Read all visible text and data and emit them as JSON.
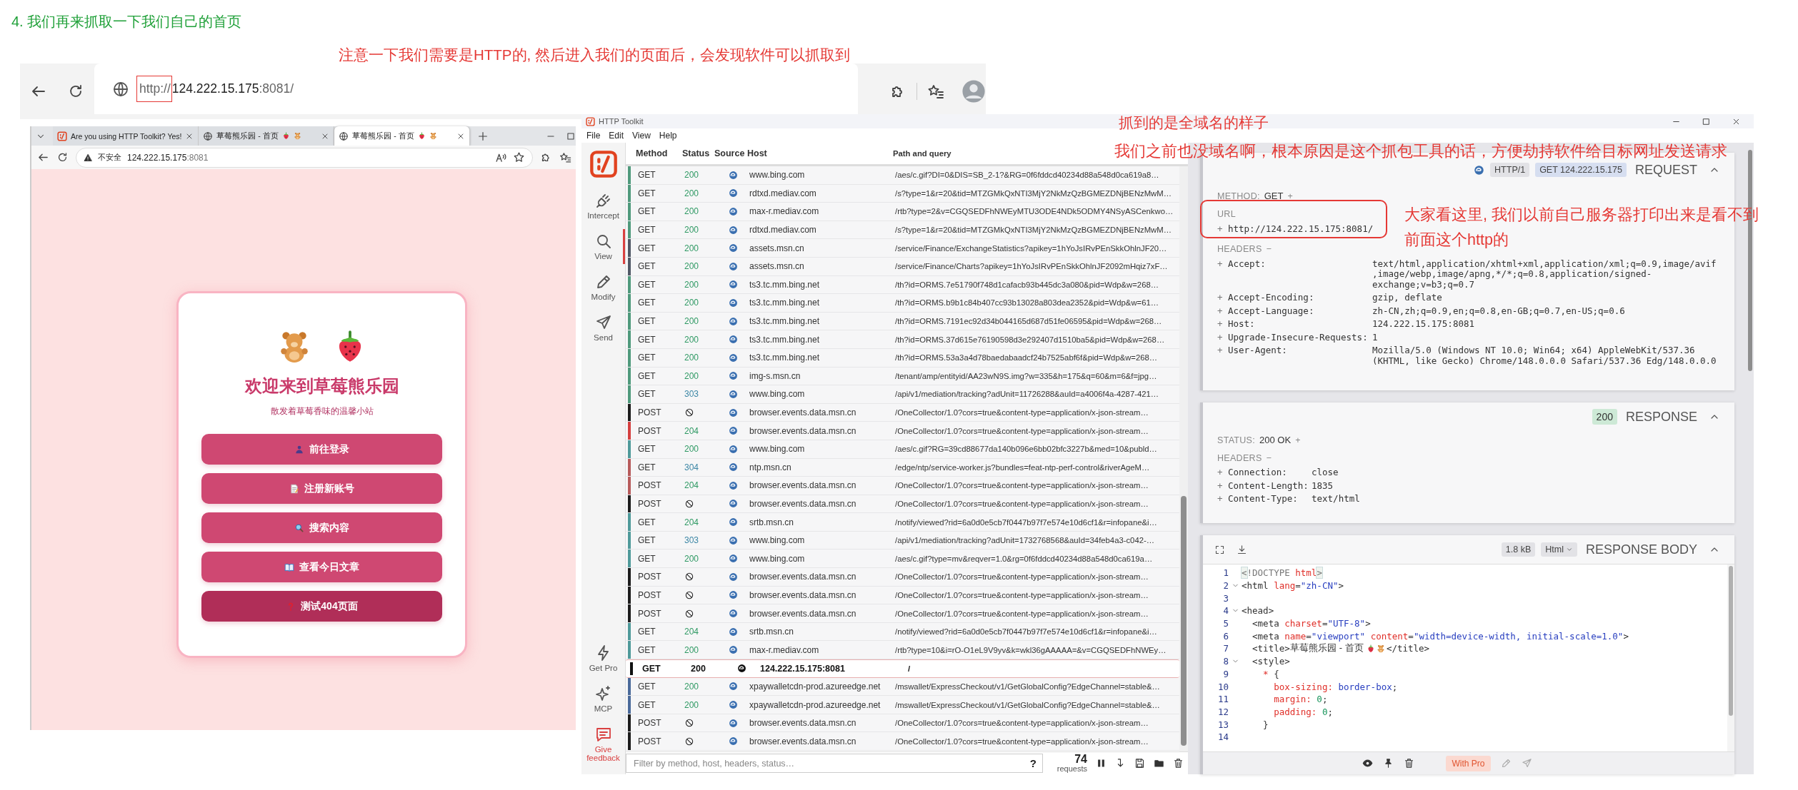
{
  "heading": "4. 我们再来抓取一下我们自己的首页",
  "annotations": [
    "注意一下我们需要是HTTP的, 然后进入我们的页面后，会发现软件可以抓取到",
    "抓到的是全域名的样子",
    "我们之前也没域名啊，根本原因是这个抓包工具的话，方便劫持软件给目标网址发送请求",
    "大家看这里, 我们以前自己服务器打印出来是看不到",
    "前面这个http的"
  ],
  "address_strip": {
    "url_scheme": "http://",
    "url_host": "124.222.15.175",
    "url_rest": ":8081/"
  },
  "browser": {
    "tabs": [
      {
        "title": "Are you using HTTP Toolkit? Yes!",
        "kind": "toolkit",
        "selected": false
      },
      {
        "title": "草莓熊乐园 - 首页",
        "kind": "site",
        "selected": false
      },
      {
        "title": "草莓熊乐园 - 首页",
        "kind": "site",
        "selected": true
      }
    ],
    "security": "不安全",
    "url_host": "124.222.15.175",
    "url_port": ":8081",
    "page": {
      "title": "欢迎来到草莓熊乐园",
      "subtitle": "散发着草莓香味的温馨小站",
      "buttons": [
        {
          "label": "前往登录",
          "kind": "login"
        },
        {
          "label": "注册新账号",
          "kind": "register"
        },
        {
          "label": "搜索内容",
          "kind": "search"
        },
        {
          "label": "查看今日文章",
          "kind": "article"
        },
        {
          "label": "测试404页面",
          "kind": "test"
        }
      ]
    }
  },
  "toolkit": {
    "title": "HTTP Toolkit",
    "menu": [
      "File",
      "Edit",
      "View",
      "Help"
    ],
    "nav": [
      {
        "label": "Intercept",
        "kind": "intercept",
        "selected": false
      },
      {
        "label": "View",
        "kind": "view",
        "selected": true
      },
      {
        "label": "Modify",
        "kind": "modify",
        "selected": false
      },
      {
        "label": "Send",
        "kind": "send",
        "selected": false
      }
    ],
    "nav_bottom": [
      {
        "label": "Get Pro",
        "kind": "pro"
      },
      {
        "label": "MCP",
        "kind": "mcp"
      },
      {
        "label": "Give feedback",
        "kind": "feedback"
      }
    ],
    "columns": [
      "Method",
      "Status",
      "Source",
      "Host",
      "Path and query"
    ],
    "rows": [
      {
        "method": "GET",
        "kind": "response",
        "status": "200",
        "host": "www.bing.com",
        "path": "/aes/c.gif?DI=0&DIS=SB_2-1?&RG=0f6fddcd40234d88a548d0ca619a8…",
        "color": "#4f9a7c",
        "selected": false
      },
      {
        "method": "GET",
        "kind": "response",
        "status": "200",
        "host": "rdtxd.mediav.com",
        "path": "/s?type=1&r=20&tid=MTZGMkQxNTI3MjY2NkMzQzBGMEZDNjBENzMwM…",
        "color": "#4f9a7c",
        "selected": false
      },
      {
        "method": "GET",
        "kind": "response",
        "status": "200",
        "host": "max-r.mediav.com",
        "path": "/rtb?type=2&v=CGQSEDFhNWEyMTU3ODE4NDk5ODMY4NSyASCenkwo…",
        "color": "#4f9a7c",
        "selected": false
      },
      {
        "method": "GET",
        "kind": "response",
        "status": "200",
        "host": "rdtxd.mediav.com",
        "path": "/s?type=1&r=20&tid=MTZGMkQxNTI3MjY2NkMzQzBGMEZDNjBENzMwM…",
        "color": "#4f9a7c",
        "selected": false
      },
      {
        "method": "GET",
        "kind": "response",
        "status": "200",
        "host": "assets.msn.cn",
        "path": "/service/Finance/ExchangeStatistics?apikey=1hYoJsIRvPEnSkkOhlnJF20…",
        "color": "#505866",
        "selected": false
      },
      {
        "method": "GET",
        "kind": "response",
        "status": "200",
        "host": "assets.msn.cn",
        "path": "/service/Finance/Charts?apikey=1hYoJsIRvPEnSkkOhlnJF2092mHqiz7xF…",
        "color": "#505866",
        "selected": false
      },
      {
        "method": "GET",
        "kind": "response",
        "status": "200",
        "host": "ts3.tc.mm.bing.net",
        "path": "/th?id=ORMS.7e51790f748d1cafacb93b445dc3a080&pid=Wdp&w=268…",
        "color": "#4f9a7c",
        "selected": false
      },
      {
        "method": "GET",
        "kind": "response",
        "status": "200",
        "host": "ts3.tc.mm.bing.net",
        "path": "/th?id=ORMS.b9b1c84b407cc93b13028a803dea2352&pid=Wdp&w=61…",
        "color": "#4f9a7c",
        "selected": false
      },
      {
        "method": "GET",
        "kind": "response",
        "status": "200",
        "host": "ts3.tc.mm.bing.net",
        "path": "/th?id=ORMS.7191ec92d34b044165d687d51fe06595&pid=Wdp&w=268…",
        "color": "#4f9a7c",
        "selected": false
      },
      {
        "method": "GET",
        "kind": "response",
        "status": "200",
        "host": "ts3.tc.mm.bing.net",
        "path": "/th?id=ORMS.37d615e76190598d3e292407d1510ba5&pid=Wdp&w=268…",
        "color": "#4f9a7c",
        "selected": false
      },
      {
        "method": "GET",
        "kind": "response",
        "status": "200",
        "host": "ts3.tc.mm.bing.net",
        "path": "/th?id=ORMS.53a3a4d78baedabaadcf24b7525abf6f&pid=Wdp&w=268…",
        "color": "#4f9a7c",
        "selected": false
      },
      {
        "method": "GET",
        "kind": "response",
        "status": "200",
        "host": "img-s.msn.cn",
        "path": "/tenant/amp/entityid/AA23wN9S.img?w=335&h=175&q=60&m=6&f=jpg…",
        "color": "#4f9a7c",
        "selected": false
      },
      {
        "method": "GET",
        "kind": "response",
        "status": "303",
        "host": "www.bing.com",
        "path": "/api/v1/mediation/tracking?adUnit=11726288&auId=a4006f4a-4287-421…",
        "color": "#4f9a7c",
        "selected": false
      },
      {
        "method": "POST",
        "kind": "aborted",
        "host": "browser.events.data.msn.cn",
        "path": "/OneCollector/1.0?cors=true&content-type=application/x-json-stream…",
        "color": "#1c1c1c",
        "selected": false
      },
      {
        "method": "POST",
        "kind": "response",
        "status": "204",
        "host": "browser.events.data.msn.cn",
        "path": "/OneCollector/1.0?cors=true&content-type=application/x-json-stream…",
        "color": "#d43f3f",
        "selected": false
      },
      {
        "method": "GET",
        "kind": "response",
        "status": "200",
        "host": "www.bing.com",
        "path": "/aes/c.gif?RG=39cd88677da140b096e6bb02bfc3227b&med=10&publd…",
        "color": "#4f9a9a",
        "selected": false
      },
      {
        "method": "GET",
        "kind": "response",
        "status": "304",
        "host": "ntp.msn.cn",
        "path": "/edge/ntp/service-worker.js?bundles=feat-ntp-perf-control&riverAgeM…",
        "color": "#b75b5b",
        "selected": false
      },
      {
        "method": "POST",
        "kind": "response",
        "status": "204",
        "host": "browser.events.data.msn.cn",
        "path": "/OneCollector/1.0?cors=true&content-type=application/x-json-stream…",
        "color": "#b75b5b",
        "selected": false
      },
      {
        "method": "POST",
        "kind": "aborted",
        "host": "browser.events.data.msn.cn",
        "path": "/OneCollector/1.0?cors=true&content-type=application/x-json-stream…",
        "color": "#1c1c1c",
        "selected": false
      },
      {
        "method": "GET",
        "kind": "response",
        "status": "204",
        "host": "srtb.msn.cn",
        "path": "/notify/viewed?rid=6a0d0e5cb7f0447b97f7e574e10d6cf1&r=infopane&i…",
        "color": "#4f9a9a",
        "selected": false
      },
      {
        "method": "GET",
        "kind": "response",
        "status": "303",
        "host": "www.bing.com",
        "path": "/api/v1/mediation/tracking?adUnit=1732768568&auId=34feb4a3-c042-…",
        "color": "#4f9a9a",
        "selected": false
      },
      {
        "method": "GET",
        "kind": "response",
        "status": "200",
        "host": "www.bing.com",
        "path": "/aes/c.gif?type=mv&reqver=1.0&rg=0f6fddcd40234d88a548d0ca619a…",
        "color": "#4f9a9a",
        "selected": false
      },
      {
        "method": "POST",
        "kind": "aborted",
        "host": "browser.events.data.msn.cn",
        "path": "/OneCollector/1.0?cors=true&content-type=application/x-json-stream…",
        "color": "#1c1c1c",
        "selected": false
      },
      {
        "method": "POST",
        "kind": "aborted",
        "host": "browser.events.data.msn.cn",
        "path": "/OneCollector/1.0?cors=true&content-type=application/x-json-stream…",
        "color": "#1c1c1c",
        "selected": false
      },
      {
        "method": "POST",
        "kind": "aborted",
        "host": "browser.events.data.msn.cn",
        "path": "/OneCollector/1.0?cors=true&content-type=application/x-json-stream…",
        "color": "#1c1c1c",
        "selected": false
      },
      {
        "method": "GET",
        "kind": "response",
        "status": "204",
        "host": "srtb.msn.cn",
        "path": "/notify/viewed?rid=6a0d0e5cb7f0447b97f7e574e10d6cf1&r=infopane&i…",
        "color": "#4f9a9a",
        "selected": false
      },
      {
        "method": "GET",
        "kind": "response",
        "status": "200",
        "host": "max-r.mediav.com",
        "path": "/rtb?type=10&i=rO-O1eL9V9yv&k=wkl36gAAAAA=&v=CGQSEDFhNWEy…",
        "color": "#4f9a9a",
        "selected": false
      },
      {
        "method": "GET",
        "kind": "response",
        "status": "200",
        "host": "124.222.15.175:8081",
        "path": "/",
        "color": "#111111",
        "selected": true
      },
      {
        "method": "GET",
        "kind": "response",
        "status": "200",
        "host": "xpaywalletcdn-prod.azureedge.net",
        "path": "/mswallet/ExpressCheckout/v1/GetGlobalConfig?EdgeChannel=stable&…",
        "color": "#4a6a9a",
        "selected": false
      },
      {
        "method": "GET",
        "kind": "response",
        "status": "200",
        "host": "xpaywalletcdn-prod.azureedge.net",
        "path": "/mswallet/ExpressCheckout/v1/GetGlobalConfig?EdgeChannel=stable&…",
        "color": "#4a6a9a",
        "selected": false
      },
      {
        "method": "POST",
        "kind": "aborted",
        "host": "browser.events.data.msn.cn",
        "path": "/OneCollector/1.0?cors=true&content-type=application/x-json-stream…",
        "color": "#1c1c1c",
        "selected": false
      },
      {
        "method": "POST",
        "kind": "aborted",
        "host": "browser.events.data.msn.cn",
        "path": "/OneCollector/1.0?cors=true&content-type=application/x-json-stream…",
        "color": "#1c1c1c",
        "selected": false
      }
    ],
    "filter": {
      "placeholder": "Filter by method, host, headers, status…",
      "help": "?"
    },
    "count": "74",
    "count_label": "requests",
    "request": {
      "protocol": "HTTP/1",
      "summary": "GET 124.222.15.175",
      "title": "REQUEST",
      "method_label": "METHOD:",
      "method": "GET",
      "method_toggle": "+",
      "url_label": "URL",
      "url_toggle": "+",
      "url": "http://124.222.15.175:8081/",
      "headers_label": "HEADERS",
      "headers_toggle": "−",
      "headers": [
        {
          "toggle": "+",
          "name": "Accept:",
          "value": "text/html,application/xhtml+xml,application/xml;q=0.9,image/avif,image/webp,image/apng,*/*;q=0.8,application/signed-exchange;v=b3;q=0.7"
        },
        {
          "toggle": "+",
          "name": "Accept-Encoding:",
          "value": "gzip, deflate"
        },
        {
          "toggle": "+",
          "name": "Accept-Language:",
          "value": "zh-CN,zh;q=0.9,en;q=0.8,en-GB;q=0.7,en-US;q=0.6"
        },
        {
          "toggle": "+",
          "name": "Host:",
          "value": "124.222.15.175:8081"
        },
        {
          "toggle": "+",
          "name": "Upgrade-Insecure-Requests:",
          "value": "1"
        },
        {
          "toggle": "+",
          "name": "User-Agent:",
          "value": "Mozilla/5.0 (Windows NT 10.0; Win64; x64) AppleWebKit/537.36 (KHTML, like Gecko) Chrome/148.0.0.0 Safari/537.36 Edg/148.0.0.0"
        }
      ]
    },
    "response": {
      "status_badge": "200",
      "title": "RESPONSE",
      "status_label": "STATUS:",
      "status": "200 OK",
      "status_toggle": "+",
      "headers_label": "HEADERS",
      "headers_toggle": "−",
      "headers": [
        {
          "toggle": "+",
          "name": "Connection:",
          "value": "close"
        },
        {
          "toggle": "+",
          "name": "Content-Length:",
          "value": "1835"
        },
        {
          "toggle": "+",
          "name": "Content-Type:",
          "value": "text/html"
        }
      ]
    },
    "body": {
      "size": "1.8 kB",
      "format": "Html",
      "title": "RESPONSE BODY",
      "lines": [
        {
          "number": "1",
          "fold": false,
          "tokens": [
            {
              "kind": "bracket",
              "text": "<"
            },
            {
              "kind": "keyword",
              "text": "!DOCTYPE "
            },
            {
              "kind": "name",
              "text": "html"
            },
            {
              "kind": "bracket",
              "text": ">"
            }
          ]
        },
        {
          "number": "2",
          "fold": true,
          "tokens": [
            {
              "kind": "tag",
              "text": "<html "
            },
            {
              "kind": "name",
              "text": "lang"
            },
            {
              "kind": "tag",
              "text": "="
            },
            {
              "kind": "string",
              "text": "\"zh-CN\""
            },
            {
              "kind": "tag",
              "text": ">"
            }
          ]
        },
        {
          "number": "3",
          "fold": false
        },
        {
          "number": "4",
          "fold": true,
          "tokens": [
            {
              "kind": "tag",
              "text": "<head>"
            }
          ]
        },
        {
          "number": "5",
          "fold": false,
          "tokens": [
            {
              "kind": "tag",
              "text": "  <meta "
            },
            {
              "kind": "name",
              "text": "charset"
            },
            {
              "kind": "tag",
              "text": "="
            },
            {
              "kind": "string",
              "text": "\"UTF-8\""
            },
            {
              "kind": "tag",
              "text": ">"
            }
          ]
        },
        {
          "number": "6",
          "fold": false,
          "tokens": [
            {
              "kind": "tag",
              "text": "  <meta "
            },
            {
              "kind": "name",
              "text": "name"
            },
            {
              "kind": "tag",
              "text": "="
            },
            {
              "kind": "string",
              "text": "\"viewport\""
            },
            {
              "kind": "name",
              "text": " content"
            },
            {
              "kind": "tag",
              "text": "="
            },
            {
              "kind": "string",
              "text": "\"width=device-width, initial-scale=1.0\""
            },
            {
              "kind": "tag",
              "text": ">"
            }
          ]
        },
        {
          "number": "7",
          "fold": false,
          "tokens": [
            {
              "kind": "tag",
              "text": "  <title>"
            },
            {
              "kind": "text",
              "text": "草莓熊乐园 - 首页 "
            },
            {
              "kind": "strawberry"
            },
            {
              "kind": "bear"
            },
            {
              "kind": "tag",
              "text": "</title>"
            }
          ]
        },
        {
          "number": "8",
          "fold": true,
          "tokens": [
            {
              "kind": "tag",
              "text": "  <style>"
            }
          ]
        },
        {
          "number": "9",
          "fold": false,
          "tokens": [
            {
              "kind": "name",
              "text": "    *"
            },
            {
              "kind": "tag",
              "text": " {"
            }
          ]
        },
        {
          "number": "10",
          "fold": false,
          "tokens": [
            {
              "kind": "name",
              "text": "      box-sizing:"
            },
            {
              "kind": "string",
              "text": " border-box"
            },
            {
              "kind": "tag",
              "text": ";"
            }
          ]
        },
        {
          "number": "11",
          "fold": false,
          "tokens": [
            {
              "kind": "name",
              "text": "      margin:"
            },
            {
              "kind": "number",
              "text": " 0"
            },
            {
              "kind": "tag",
              "text": ";"
            }
          ]
        },
        {
          "number": "12",
          "fold": false,
          "tokens": [
            {
              "kind": "name",
              "text": "      padding:"
            },
            {
              "kind": "number",
              "text": " 0"
            },
            {
              "kind": "tag",
              "text": ";"
            }
          ]
        },
        {
          "number": "13",
          "fold": false,
          "tokens": [
            {
              "kind": "tag",
              "text": "    }"
            }
          ]
        },
        {
          "number": "14",
          "fold": false
        }
      ]
    },
    "pro_button": "With Pro"
  }
}
